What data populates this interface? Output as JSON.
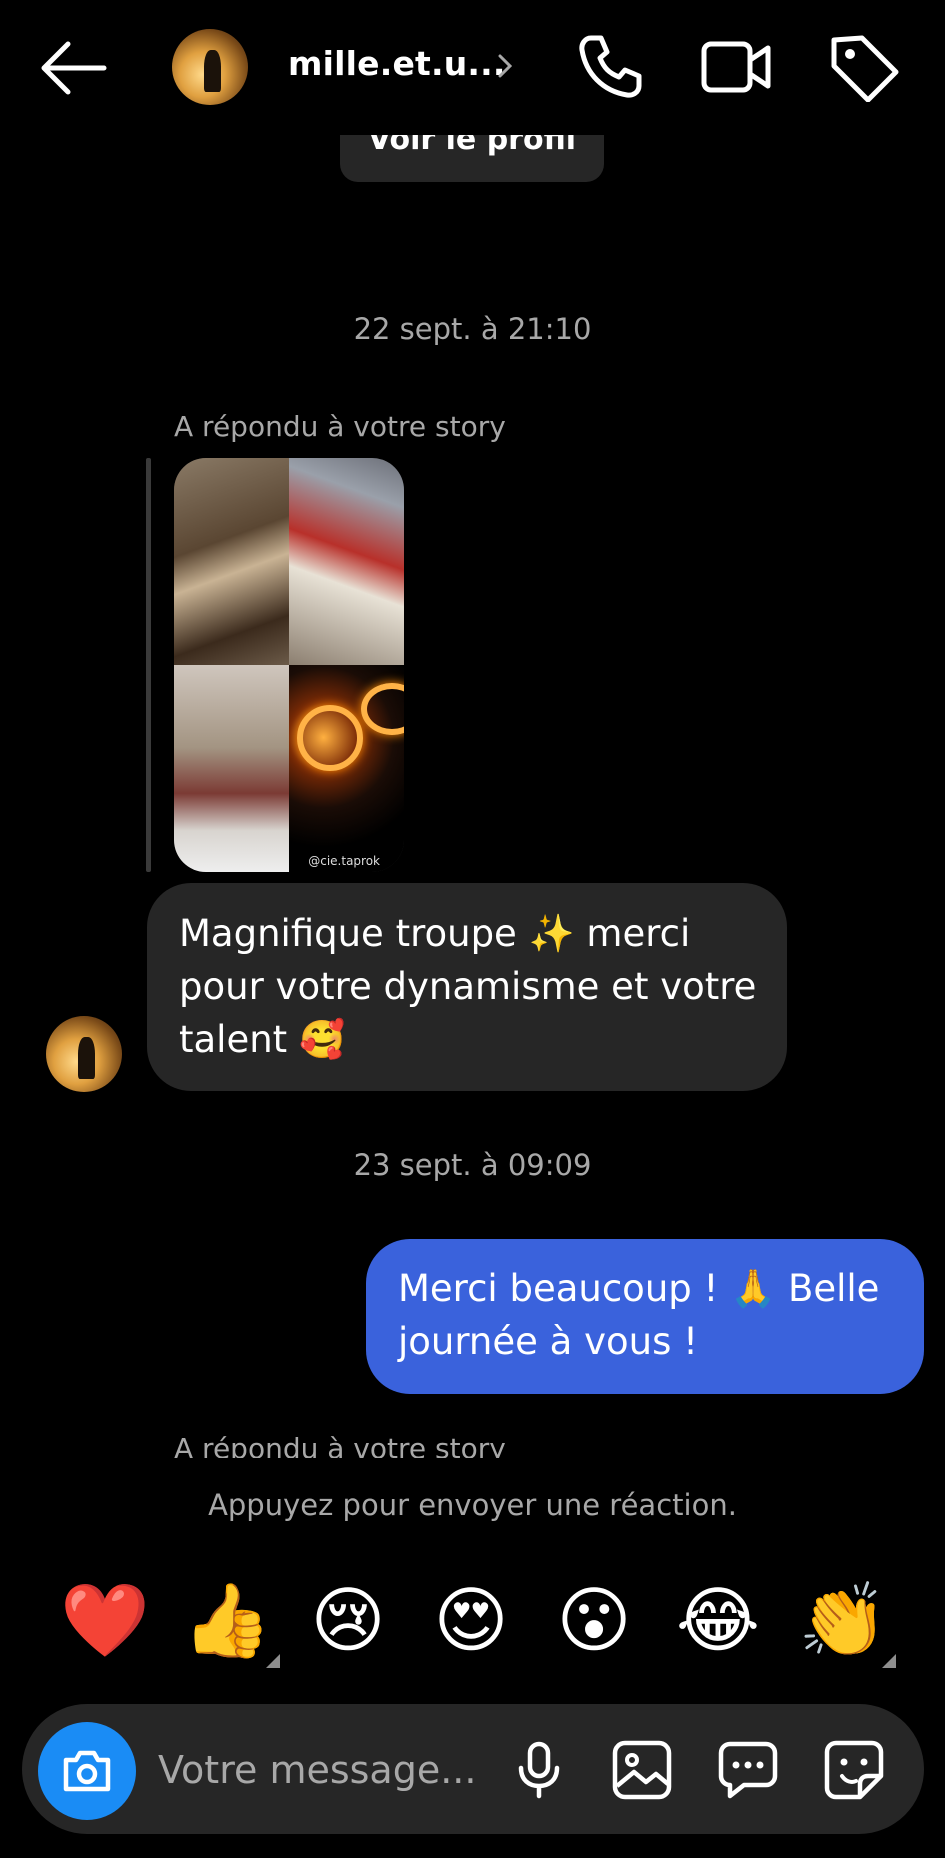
{
  "header": {
    "username": "mille.et.u...",
    "view_profile": "Voir le profil"
  },
  "messages": {
    "timestamp_1": "22 sept. à 21:10",
    "replied_label": "A répondu à votre story",
    "story_credit": "@cie.taprok",
    "incoming_text": "Magnifique troupe ✨ merci pour votre dynamisme et votre talent 🥰",
    "timestamp_2": "23 sept. à 09:09",
    "outgoing_text": "Merci beaucoup ! 🙏 Belle journée à vous !",
    "replied_label_2": "A répondu à votre story"
  },
  "reactions": {
    "hint": "Appuyez pour envoyer une réaction.",
    "emojis": [
      "❤️",
      "👍",
      "😢",
      "😍",
      "😮",
      "😂",
      "👏"
    ]
  },
  "composer": {
    "placeholder": "Votre message..."
  },
  "colors": {
    "background": "#000000",
    "incoming_bubble": "#262626",
    "outgoing_bubble": "#3a62dc",
    "camera_button": "#1a8cf5",
    "secondary_text": "#a8a8a8"
  },
  "icons": [
    "back-arrow-icon",
    "chevron-right-icon",
    "phone-icon",
    "video-camera-icon",
    "tag-icon",
    "camera-icon",
    "microphone-icon",
    "gallery-icon",
    "chat-bubble-icon",
    "sticker-icon"
  ]
}
